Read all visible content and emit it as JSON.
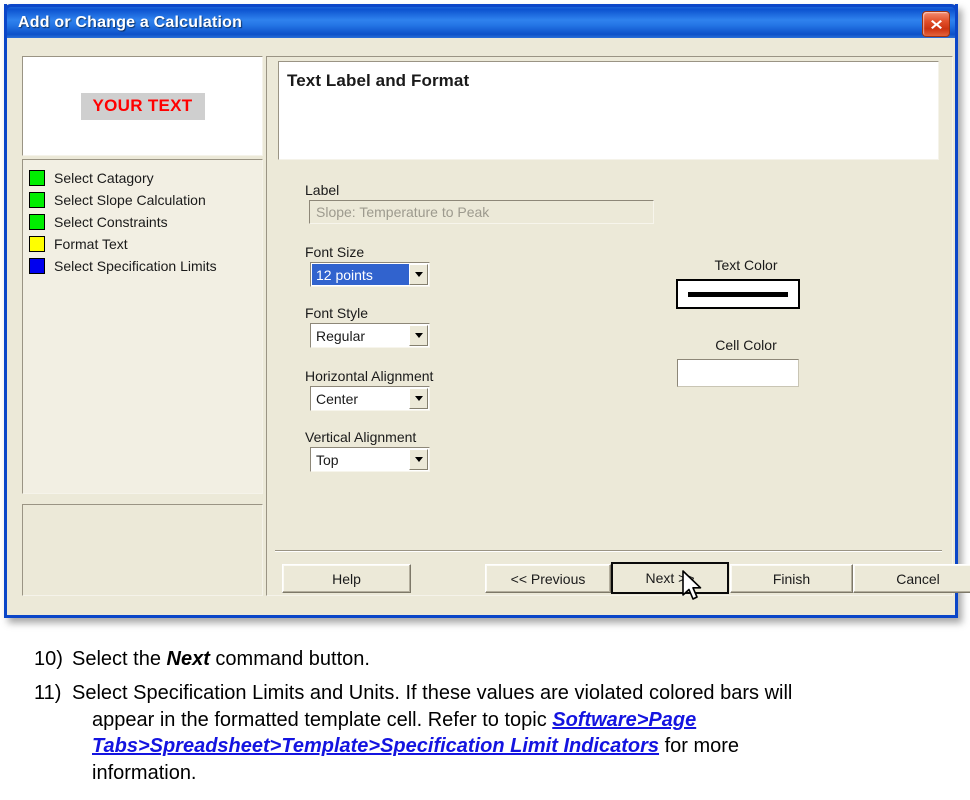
{
  "window": {
    "title": "Add or Change a Calculation",
    "close_icon": "close-icon"
  },
  "preview": {
    "text": "YOUR TEXT",
    "text_color": "#ff0000",
    "cell_color": "#cfcfcf"
  },
  "steps": [
    {
      "label": "Select Catagory",
      "color": "#00ee00"
    },
    {
      "label": "Select Slope Calculation",
      "color": "#00ee00"
    },
    {
      "label": "Select Constraints",
      "color": "#00ee00"
    },
    {
      "label": "Format Text",
      "color": "#ffff00"
    },
    {
      "label": "Select Specification Limits",
      "color": "#0000ee"
    }
  ],
  "panel": {
    "banner_title": "Text Label and Format",
    "label_field": {
      "label": "Label",
      "value": "Slope: Temperature to Peak",
      "placeholder": "Slope: Temperature to Peak"
    },
    "font_size": {
      "label": "Font Size",
      "value": "12 points"
    },
    "font_style": {
      "label": "Font Style",
      "value": "Regular"
    },
    "horizontal_alignment": {
      "label": "Horizontal Alignment",
      "value": "Center"
    },
    "vertical_alignment": {
      "label": "Vertical Alignment",
      "value": "Top"
    },
    "text_color": {
      "label": "Text Color",
      "value": "#000000"
    },
    "cell_color": {
      "label": "Cell Color",
      "value": "#ffffff"
    }
  },
  "buttons": {
    "help": "Help",
    "previous": "<< Previous",
    "next": "Next >>",
    "finish": "Finish",
    "cancel": "Cancel"
  },
  "instructions": [
    {
      "number": "10)",
      "pre": "Select the ",
      "emphasis": "Next",
      "post": " command button."
    },
    {
      "number": "11)",
      "line1": "Select Specification Limits and Units. If these values are violated colored bars will",
      "line2_pre": "appear in the formatted template cell. Refer to   topic ",
      "link": "Software>Page Tabs>Spreadsheet>Template>Specification Limit Indicators",
      "line2_post": " for more",
      "line3": "information."
    }
  ]
}
